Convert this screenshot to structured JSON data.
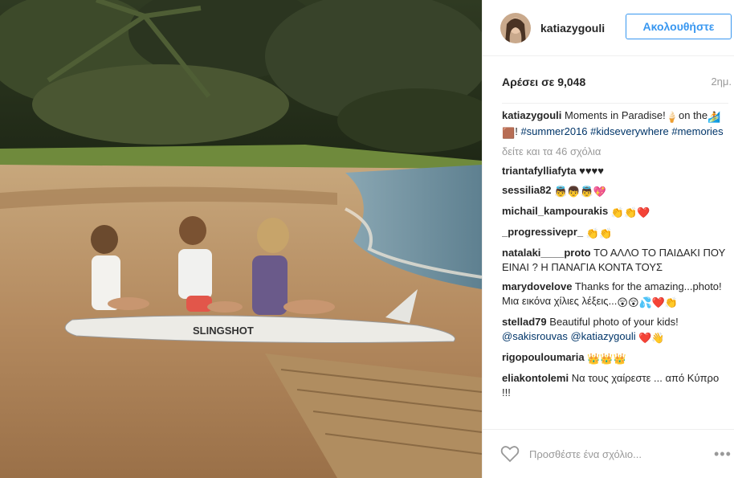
{
  "photo": {
    "board_text": "SLINGSHOT"
  },
  "header": {
    "username": "katiazygouli",
    "follow_label": "Ακολουθήστε"
  },
  "meta": {
    "likes": "Αρέσει σε 9,048",
    "time": "2ημ."
  },
  "caption": {
    "user": "katiazygouli",
    "text1": "Moments in Paradise!",
    "text2": "on",
    "text3": "the",
    "text4": "!",
    "tags": [
      "#summer2016",
      "#kidseverywhere",
      "#memories"
    ]
  },
  "more_comments": "δείτε και τα 46 σχόλια",
  "comments": [
    {
      "user": "triantafylliafyta",
      "text": "♥♥♥♥"
    },
    {
      "user": "sessilia82",
      "text": ""
    },
    {
      "user": "michail_kampourakis",
      "text": ""
    },
    {
      "user": "_progressivepr_",
      "text": ""
    },
    {
      "user": "natalaki____proto",
      "text": "ΤΟ ΑΛΛΟ ΤΟ ΠΑΙΔΑΚΙ ΠΟΥ ΕΙΝΑΙ ? Η ΠΑΝΑΓΙΑ ΚΟΝΤΑ ΤΟΥΣ"
    },
    {
      "user": "marydovelove",
      "text": "Thanks for the amazing...photo! Μια εικόνα χίλιες λέξεις..."
    },
    {
      "user": "stellad79",
      "text": "Beautiful photo of your kids!",
      "mention1": "@sakisrouvas",
      "mention2": "@katiazygouli"
    },
    {
      "user": "rigopouloumaria",
      "text": ""
    },
    {
      "user": "eliakontolemi",
      "text": "Να τους χαίρεστε ... από Κύπρο !!!"
    }
  ],
  "add_comment": {
    "placeholder": "Προσθέστε ένα σχόλιο...",
    "more": "•••"
  },
  "colors": {
    "accent": "#3897f0",
    "hashtag": "#003569",
    "muted": "#999999"
  },
  "icons": [
    "heart-icon",
    "more-options-icon",
    "avatar"
  ]
}
